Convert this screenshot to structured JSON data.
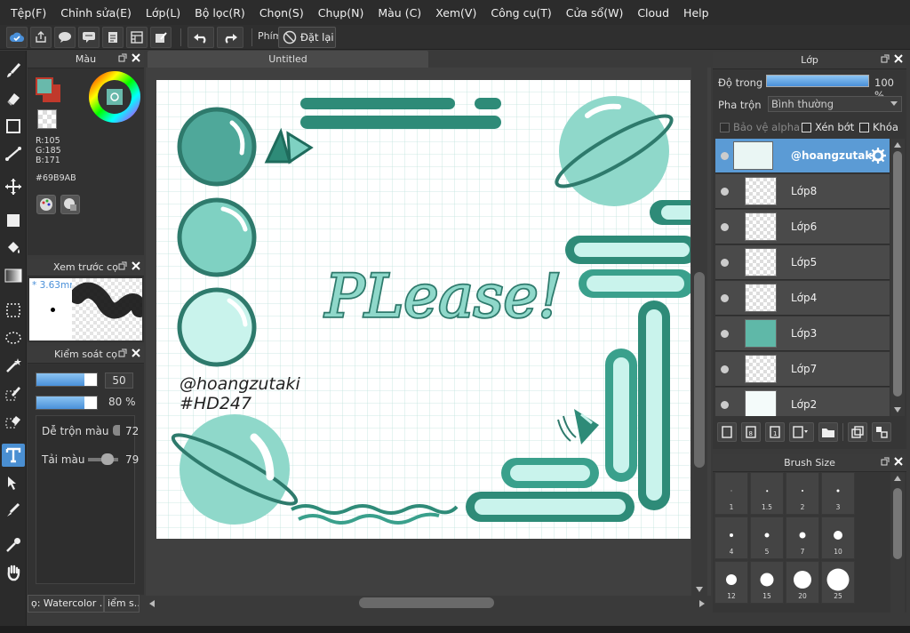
{
  "menu": [
    "Tệp(F)",
    "Chỉnh sửa(E)",
    "Lớp(L)",
    "Bộ lọc(R)",
    "Chọn(S)",
    "Chụp(N)",
    "Màu (C)",
    "Xem(V)",
    "Công cụ(T)",
    "Cửa sổ(W)",
    "Cloud",
    "Help"
  ],
  "toolbar": {
    "brush_label": "Phím",
    "reset_label": "Đặt lại"
  },
  "color_panel": {
    "title": "Màu",
    "r": "R:105",
    "g": "G:185",
    "b": "B:171",
    "hex": "#69B9AB",
    "fg_color": "#69B9AB",
    "bg_color": "#C0392B"
  },
  "preview_panel": {
    "title": "Xem trước cọ",
    "size": "* 3.63mm"
  },
  "control_panel": {
    "title": "Kiểm soát cọ",
    "size_value": "50",
    "opacity_value": "80 %",
    "size_level": 0.8,
    "opacity_level": 0.8,
    "blend_label": "Dễ trộn màu",
    "blend_value": "72",
    "load_label": "Tải màu",
    "load_value": "79"
  },
  "bottom_tabs": [
    "ọ: Watercolor .",
    "iểm s.."
  ],
  "document": {
    "tab_title": "Untitled"
  },
  "artwork": {
    "handle": "@hoangzutaki",
    "tag": "#HD247",
    "headline": "PLease!",
    "accent": "#2E8B78",
    "light": "#8FD8CA"
  },
  "layer_panel": {
    "title": "Lớp",
    "opacity_label": "Độ trong",
    "opacity_value": "100 %",
    "blend_label": "Pha trộn",
    "blend_value": "Bình thường",
    "protect_alpha": "Bảo vệ alpha",
    "clipping": "Xén bớt",
    "lock": "Khóa",
    "layers": [
      {
        "name": "@hoangzutaki",
        "selected": true
      },
      {
        "name": "Lớp8"
      },
      {
        "name": "Lớp6"
      },
      {
        "name": "Lớp5"
      },
      {
        "name": "Lớp4"
      },
      {
        "name": "Lớp3"
      },
      {
        "name": "Lớp7"
      },
      {
        "name": "Lớp2"
      }
    ]
  },
  "brush_size_panel": {
    "title": "Brush Size",
    "sizes": [
      "1",
      "1.5",
      "2",
      "3",
      "4",
      "5",
      "7",
      "10",
      "12",
      "15",
      "20",
      "25"
    ]
  }
}
